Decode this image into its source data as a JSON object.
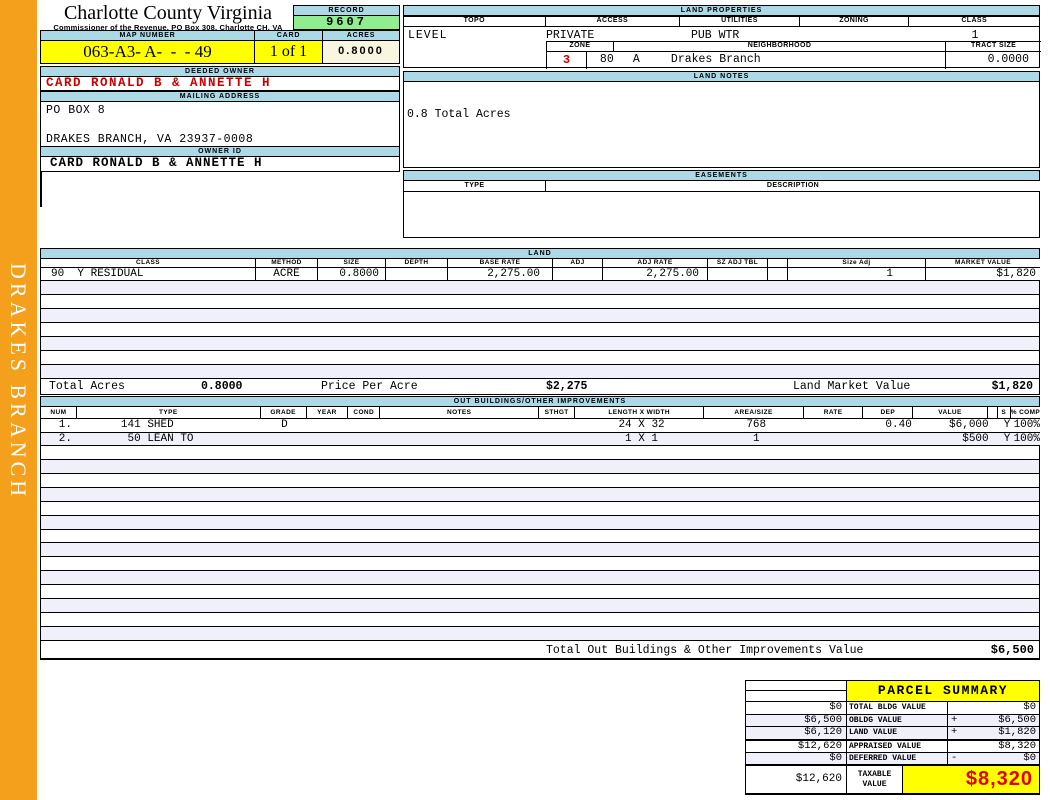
{
  "colors": {
    "orange": "#F4A01C",
    "header_blue": "#ADD8E6",
    "record_green": "#90EE90",
    "yellow": "#FFFF00",
    "cream": "#F8F5E0",
    "stripe": "#F0F0FA",
    "red": "#CC0000",
    "taxable_red": "#E10000"
  },
  "sidebar": {
    "district": "DRAKES BRANCH"
  },
  "header": {
    "county": "Charlotte County Virginia",
    "commissioner": "Commissioner of the Revenue, PO Box 308, Charlotte CH, VA",
    "record_label": "RECORD",
    "record_value": "9607",
    "map_number_label": "MAP NUMBER",
    "map_number": "063-A3- A-  -  - 49",
    "card_label": "CARD",
    "card_value": "1 of 1",
    "acres_label": "ACRES",
    "acres_value": "0.8000"
  },
  "owner": {
    "deeded_owner_label": "DEEDED OWNER",
    "deeded_owner": "CARD RONALD B & ANNETTE H",
    "mailing_address_label": "MAILING ADDRESS",
    "address_line1": "PO BOX 8",
    "address_line2": "DRAKES BRANCH, VA 23937-0008",
    "owner_id_label": "OWNER ID",
    "owner_id": "CARD RONALD B & ANNETTE H"
  },
  "land_properties": {
    "title": "LAND PROPERTIES",
    "headers": [
      "TOPO",
      "ACCESS",
      "UTILITIES",
      "ZONING",
      "CLASS"
    ],
    "topo": "LEVEL",
    "access": "PRIVATE",
    "utilities": "PUB WTR",
    "zoning": "",
    "class": "1",
    "zone_label": "ZONE",
    "neighborhood_label": "NEIGHBORHOOD",
    "tract_size_label": "TRACT SIZE",
    "zone": "3",
    "neighborhood_code": "80",
    "neighborhood_sub": "A",
    "neighborhood_name": "Drakes Branch",
    "tract_size": "0.0000"
  },
  "land_notes": {
    "title": "LAND NOTES",
    "note": "0.8 Total Acres"
  },
  "easements": {
    "title": "EASEMENTS",
    "type_label": "TYPE",
    "description_label": "DESCRIPTION"
  },
  "land_table": {
    "title": "LAND",
    "headers": [
      "CLASS",
      "METHOD",
      "SIZE",
      "DEPTH",
      "BASE RATE",
      "ADJ",
      "ADJ RATE",
      "SZ ADJ TBL",
      "",
      "Size Adj",
      "MARKET VALUE"
    ],
    "rows": [
      {
        "class": "90  Y RESIDUAL",
        "method": "ACRE",
        "size": "0.8000",
        "depth": "",
        "base_rate": "2,275.00",
        "adj": "",
        "adj_rate": "2,275.00",
        "sz_adj_tbl": "",
        "size_adj": "1",
        "market_value": "$1,820"
      }
    ],
    "empty_row_count": 7,
    "totals": {
      "total_acres_label": "Total Acres",
      "total_acres": "0.8000",
      "price_per_acre_label": "Price Per Acre",
      "price_per_acre": "$2,275",
      "land_market_value_label": "Land Market Value",
      "land_market_value": "$1,820"
    }
  },
  "out_buildings": {
    "title": "OUT BUILDINGS/OTHER IMPROVEMENTS",
    "headers": [
      "NUM",
      "TYPE",
      "GRADE",
      "YEAR",
      "COND",
      "NOTES",
      "STHGT",
      "LENGTH X WIDTH",
      "AREA/SIZE",
      "RATE",
      "DEP",
      "VALUE",
      "",
      "S",
      "% COMP"
    ],
    "rows": [
      {
        "num": "1.",
        "type": "141 SHED",
        "grade": "D",
        "year": "",
        "cond": "",
        "notes": "",
        "sthgt": "",
        "length_width": "24 X 32",
        "area_size": "768",
        "rate": "",
        "dep": "0.40",
        "value": "$6,000",
        "s": "Y",
        "pct_comp": "100%"
      },
      {
        "num": "2.",
        "type": " 50 LEAN TO",
        "grade": "",
        "year": "",
        "cond": "",
        "notes": "",
        "sthgt": "",
        "length_width": "1 X 1",
        "area_size": "1",
        "rate": "",
        "dep": "",
        "value": "$500",
        "s": "Y",
        "pct_comp": "100%"
      }
    ],
    "empty_row_count": 14,
    "total_label": "Total Out Buildings & Other Improvements Value",
    "total_value": "$6,500"
  },
  "parcel_summary": {
    "title": "PARCEL SUMMARY",
    "rows": [
      {
        "prior": "$0",
        "label": "TOTAL BLDG VALUE",
        "op": "",
        "value": "$0"
      },
      {
        "prior": "$6,500",
        "label": "OBLDG VALUE",
        "op": "+",
        "value": "$6,500"
      },
      {
        "prior": "$6,120",
        "label": "LAND VALUE",
        "op": "+",
        "value": "$1,820"
      },
      {
        "prior": "$12,620",
        "label": "APPRAISED VALUE",
        "op": "",
        "value": "$8,320"
      },
      {
        "prior": "$0",
        "label": "DEFERRED VALUE",
        "op": "-",
        "value": "$0"
      }
    ],
    "taxable": {
      "prior": "$12,620",
      "label": "TAXABLE VALUE",
      "value": "$8,320"
    }
  }
}
